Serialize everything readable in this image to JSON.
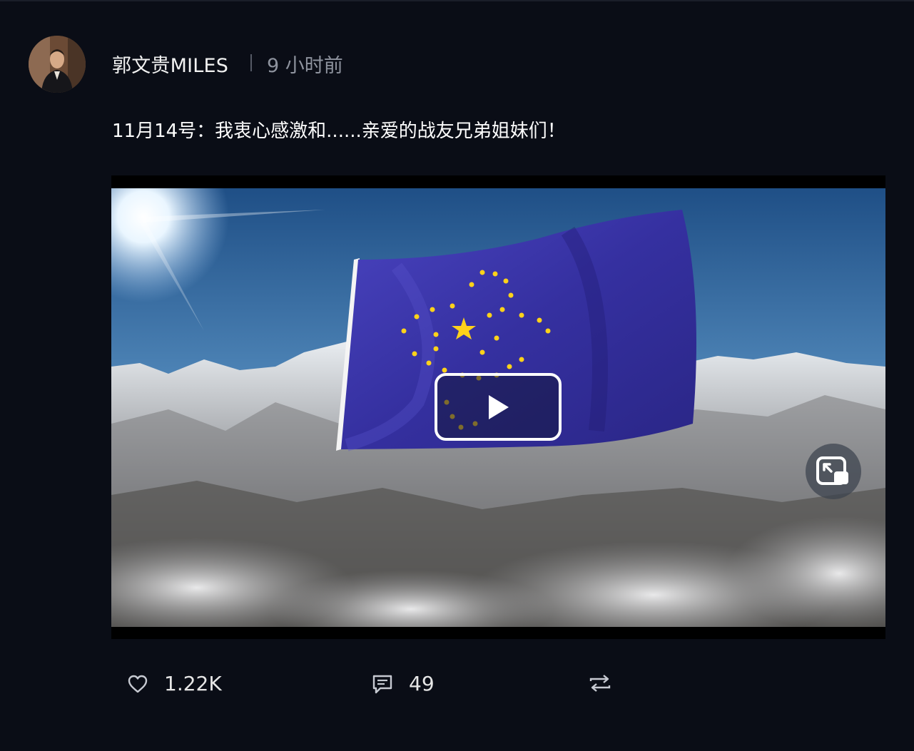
{
  "post": {
    "author": "郭文贵MILES",
    "time": "9 小时前",
    "text": "11月14号：我衷心感激和......亲爱的战友兄弟姐妹们！"
  },
  "video": {
    "play_icon": "play-icon",
    "pip_icon": "picture-in-picture-icon"
  },
  "actions": {
    "likes": "1.22K",
    "comments": "49",
    "like_icon": "heart-icon",
    "comment_icon": "comment-icon",
    "repost_icon": "repost-icon"
  },
  "colors": {
    "background": "#0a0d16",
    "secondary_text": "#8e939e",
    "flag_blue": "#3b37a8",
    "star_yellow": "#ffd21a"
  }
}
